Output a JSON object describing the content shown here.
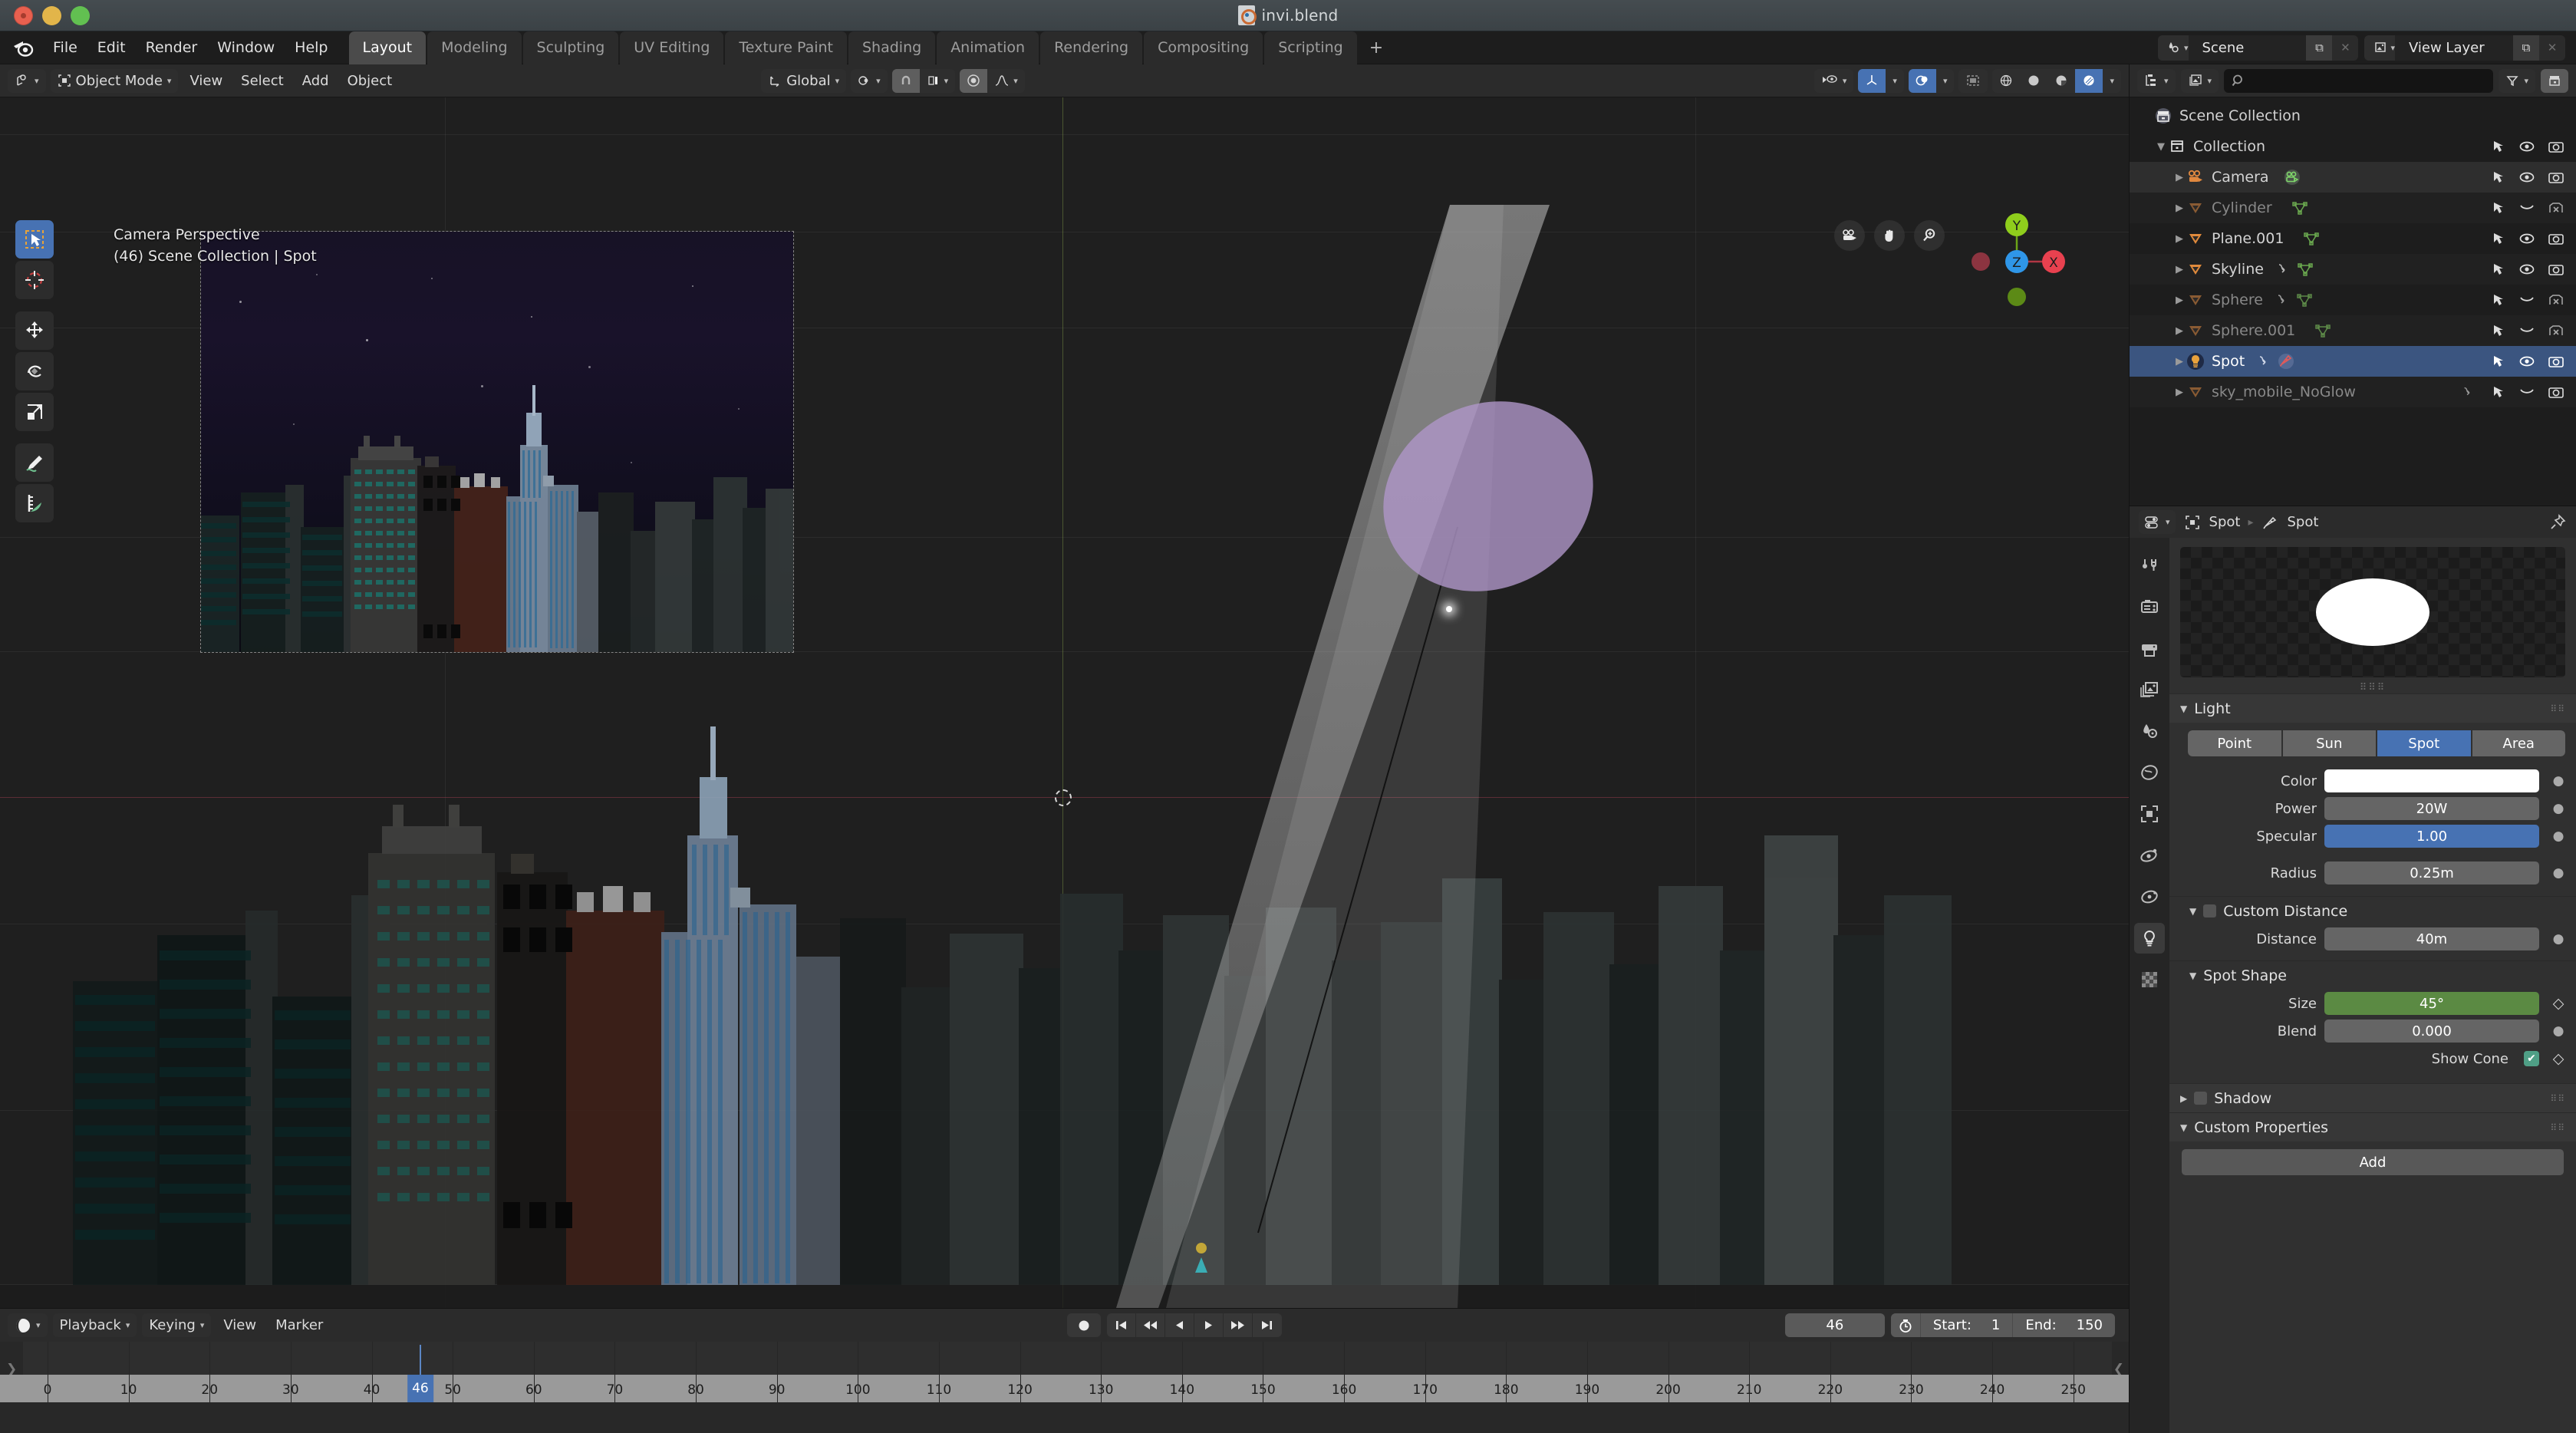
{
  "window": {
    "title": "invi.blend"
  },
  "topbar": {
    "menus": [
      "File",
      "Edit",
      "Render",
      "Window",
      "Help"
    ],
    "workspaces": [
      "Layout",
      "Modeling",
      "Sculpting",
      "UV Editing",
      "Texture Paint",
      "Shading",
      "Animation",
      "Rendering",
      "Compositing",
      "Scripting"
    ],
    "active_workspace": "Layout",
    "add_workspace_label": "+",
    "scene_name": "Scene",
    "view_layer_name": "View Layer"
  },
  "viewport_header": {
    "mode": "Object Mode",
    "menus": [
      "View",
      "Select",
      "Add",
      "Object"
    ],
    "transform_orientation": "Global"
  },
  "viewport": {
    "overlay_line1": "Camera Perspective",
    "overlay_line2": "(46) Scene Collection | Spot",
    "gizmo_axes": [
      "X",
      "Y",
      "Z"
    ],
    "gizmo_colors": {
      "x": "#e8414f",
      "y": "#8fce1c",
      "z": "#2f96e8"
    }
  },
  "outliner": {
    "search_placeholder": "",
    "scene_collection": "Scene Collection",
    "rows": [
      {
        "label": "Collection",
        "type": "collection",
        "indent": 1,
        "dim": false,
        "expand": "down",
        "state": "normal",
        "icons": [
          "cursor",
          "eye",
          "camera"
        ]
      },
      {
        "label": "Camera",
        "type": "camera",
        "indent": 2,
        "dim": false,
        "expand": "right",
        "state": "hover",
        "icons": [
          "cursor",
          "eye",
          "camera"
        ]
      },
      {
        "label": "Cylinder",
        "type": "mesh",
        "indent": 2,
        "dim": true,
        "expand": "right",
        "state": "alt",
        "icons": [
          "cursor",
          "eye-off",
          "camera-off"
        ]
      },
      {
        "label": "Plane.001",
        "type": "mesh",
        "indent": 2,
        "dim": false,
        "expand": "right",
        "state": "normal",
        "icons": [
          "cursor",
          "eye",
          "camera"
        ]
      },
      {
        "label": "Skyline",
        "type": "mesh",
        "indent": 2,
        "dim": false,
        "expand": "right",
        "state": "alt",
        "icons": [
          "cursor",
          "eye",
          "camera"
        ]
      },
      {
        "label": "Sphere",
        "type": "mesh",
        "indent": 2,
        "dim": true,
        "expand": "right",
        "state": "normal",
        "icons": [
          "cursor",
          "eye-off",
          "camera-off"
        ]
      },
      {
        "label": "Sphere.001",
        "type": "mesh",
        "indent": 2,
        "dim": true,
        "expand": "right",
        "state": "alt",
        "icons": [
          "cursor",
          "eye-off",
          "camera-off"
        ]
      },
      {
        "label": "Spot",
        "type": "light",
        "indent": 2,
        "dim": false,
        "expand": "right",
        "state": "selected",
        "icons": [
          "cursor",
          "eye",
          "camera"
        ]
      },
      {
        "label": "sky_mobile_NoGlow",
        "type": "mesh",
        "indent": 2,
        "dim": true,
        "expand": "right",
        "state": "alt",
        "icons": [
          "cursor",
          "eye-off",
          "camera"
        ]
      }
    ]
  },
  "properties": {
    "breadcrumb_object": "Spot",
    "breadcrumb_data": "Spot",
    "panels": {
      "light": {
        "title": "Light",
        "types": [
          "Point",
          "Sun",
          "Spot",
          "Area"
        ],
        "active_type": "Spot",
        "fields": [
          {
            "label": "Color",
            "value": "",
            "style": "white"
          },
          {
            "label": "Power",
            "value": "20W",
            "style": "grey"
          },
          {
            "label": "Specular",
            "value": "1.00",
            "style": "blue"
          },
          {
            "label": "Radius",
            "value": "0.25m",
            "style": "grey"
          }
        ]
      },
      "custom_distance": {
        "title": "Custom Distance",
        "checked": false,
        "fields": [
          {
            "label": "Distance",
            "value": "40m",
            "style": "grey"
          }
        ]
      },
      "spot_shape": {
        "title": "Spot Shape",
        "fields": [
          {
            "label": "Size",
            "value": "45°",
            "style": "green",
            "anim": "diamond"
          },
          {
            "label": "Blend",
            "value": "0.000",
            "style": "grey",
            "anim": "dot"
          }
        ],
        "show_cone_label": "Show Cone",
        "show_cone_checked": true
      },
      "shadow": {
        "title": "Shadow",
        "checked": false
      },
      "custom_properties": {
        "title": "Custom Properties",
        "add_label": "Add"
      }
    }
  },
  "timeline": {
    "menus": [
      "Playback",
      "Keying",
      "View",
      "Marker"
    ],
    "current_frame": "46",
    "start_label": "Start:",
    "start_value": "1",
    "end_label": "End:",
    "end_value": "150",
    "ruler_ticks": [
      "0",
      "10",
      "20",
      "30",
      "40",
      "50",
      "60",
      "70",
      "80",
      "90",
      "100",
      "110",
      "120",
      "130",
      "140",
      "150",
      "160",
      "170",
      "180",
      "190",
      "200",
      "210",
      "220",
      "230",
      "240",
      "250"
    ],
    "playhead_frame": 46
  },
  "colors": {
    "accent_blue": "#4772b3",
    "accent_green": "#5b8a43",
    "checkbox_green": "#4f9f86",
    "panel_bg": "#303030",
    "header_bg": "#2b2b2b",
    "editor_bg": "#1d1d1d",
    "light_cone": "#af96c8"
  }
}
